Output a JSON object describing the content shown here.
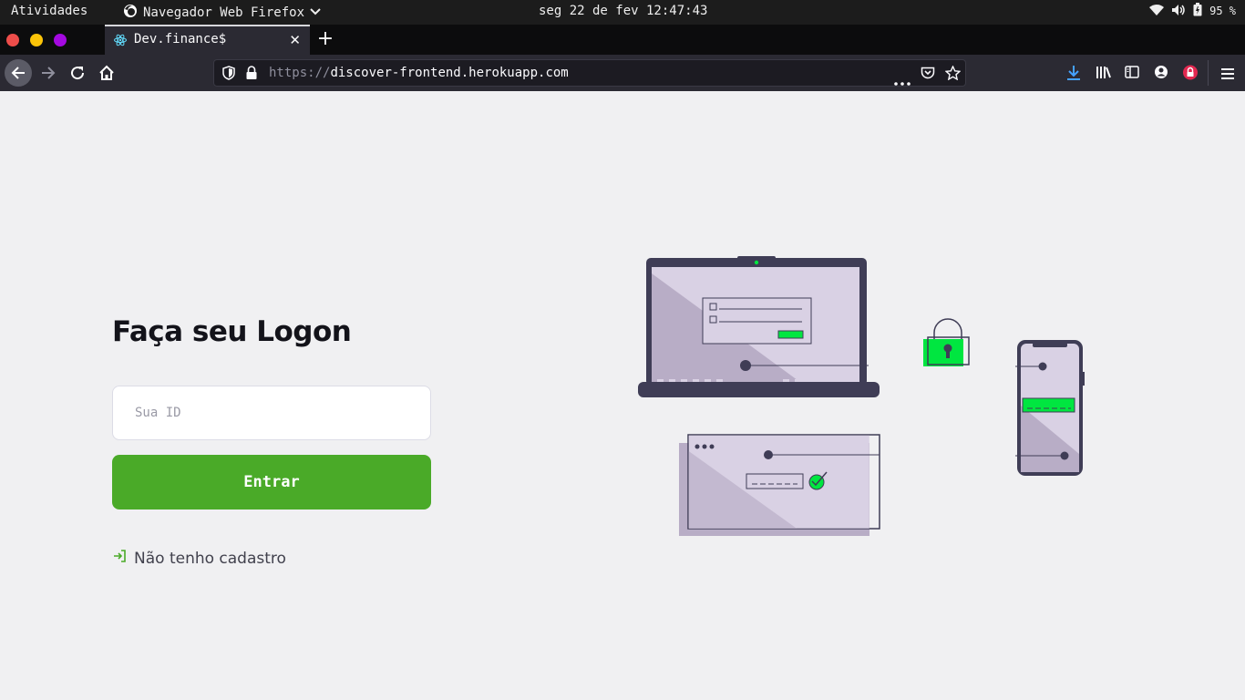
{
  "system_bar": {
    "activities": "Atividades",
    "app_name": "Navegador Web Firefox",
    "clock": "seg 22 de fev 12:47:43",
    "battery": "95 %",
    "icons": [
      "wifi-icon",
      "volume-icon",
      "battery-icon"
    ]
  },
  "browser": {
    "window_controls": [
      {
        "name": "close",
        "color": "#ed4d4a"
      },
      {
        "name": "minimize",
        "color": "#fbc408"
      },
      {
        "name": "maximize",
        "color": "#a409e0"
      }
    ],
    "tab": {
      "title": "Dev.finance$",
      "icon": "react-icon",
      "close_label": "✕"
    },
    "new_tab_label": "+",
    "url": {
      "scheme": "https://",
      "host": "discover-frontend.herokuapp.com"
    },
    "toolbar_icons": [
      "download-icon",
      "library-icon",
      "sidebar-icon",
      "account-icon",
      "extension-lock-icon",
      "menu-icon"
    ]
  },
  "login": {
    "title": "Faça seu Logon",
    "id_placeholder": "Sua ID",
    "submit_label": "Entrar",
    "register_label": "Não tenho cadastro"
  },
  "colors": {
    "accent_green": "#4aaa28",
    "illustration_green": "#00e640",
    "illustration_dark": "#3f3d56",
    "illustration_light": "#d9d1e4"
  }
}
